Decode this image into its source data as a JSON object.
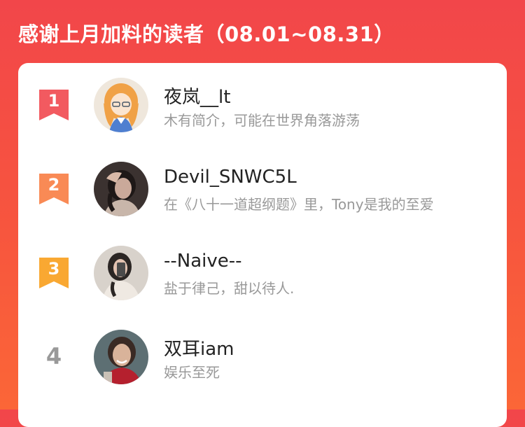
{
  "header": {
    "title": "感谢上月加料的读者（08.01~08.31）"
  },
  "colors": {
    "rank1": "#f25a60",
    "rank2": "#f98a55",
    "rank3": "#f9a832",
    "rank_plain": "#999999"
  },
  "readers": [
    {
      "rank": "1",
      "name": "夜岚__lt",
      "desc": "木有简介，可能在世界角落游荡",
      "avatar_icon": "anime-girl-avatar"
    },
    {
      "rank": "2",
      "name": "Devil_SNWC5L",
      "desc": "在《八十一道超纲题》里，Tony是我的至爱",
      "avatar_icon": "dark-portrait-avatar"
    },
    {
      "rank": "3",
      "name": "--Naive--",
      "desc": "盐于律己，甜以待人.",
      "avatar_icon": "selfie-avatar"
    },
    {
      "rank": "4",
      "name": "双耳iam",
      "desc": "娱乐至死",
      "avatar_icon": "smiling-woman-avatar"
    }
  ]
}
